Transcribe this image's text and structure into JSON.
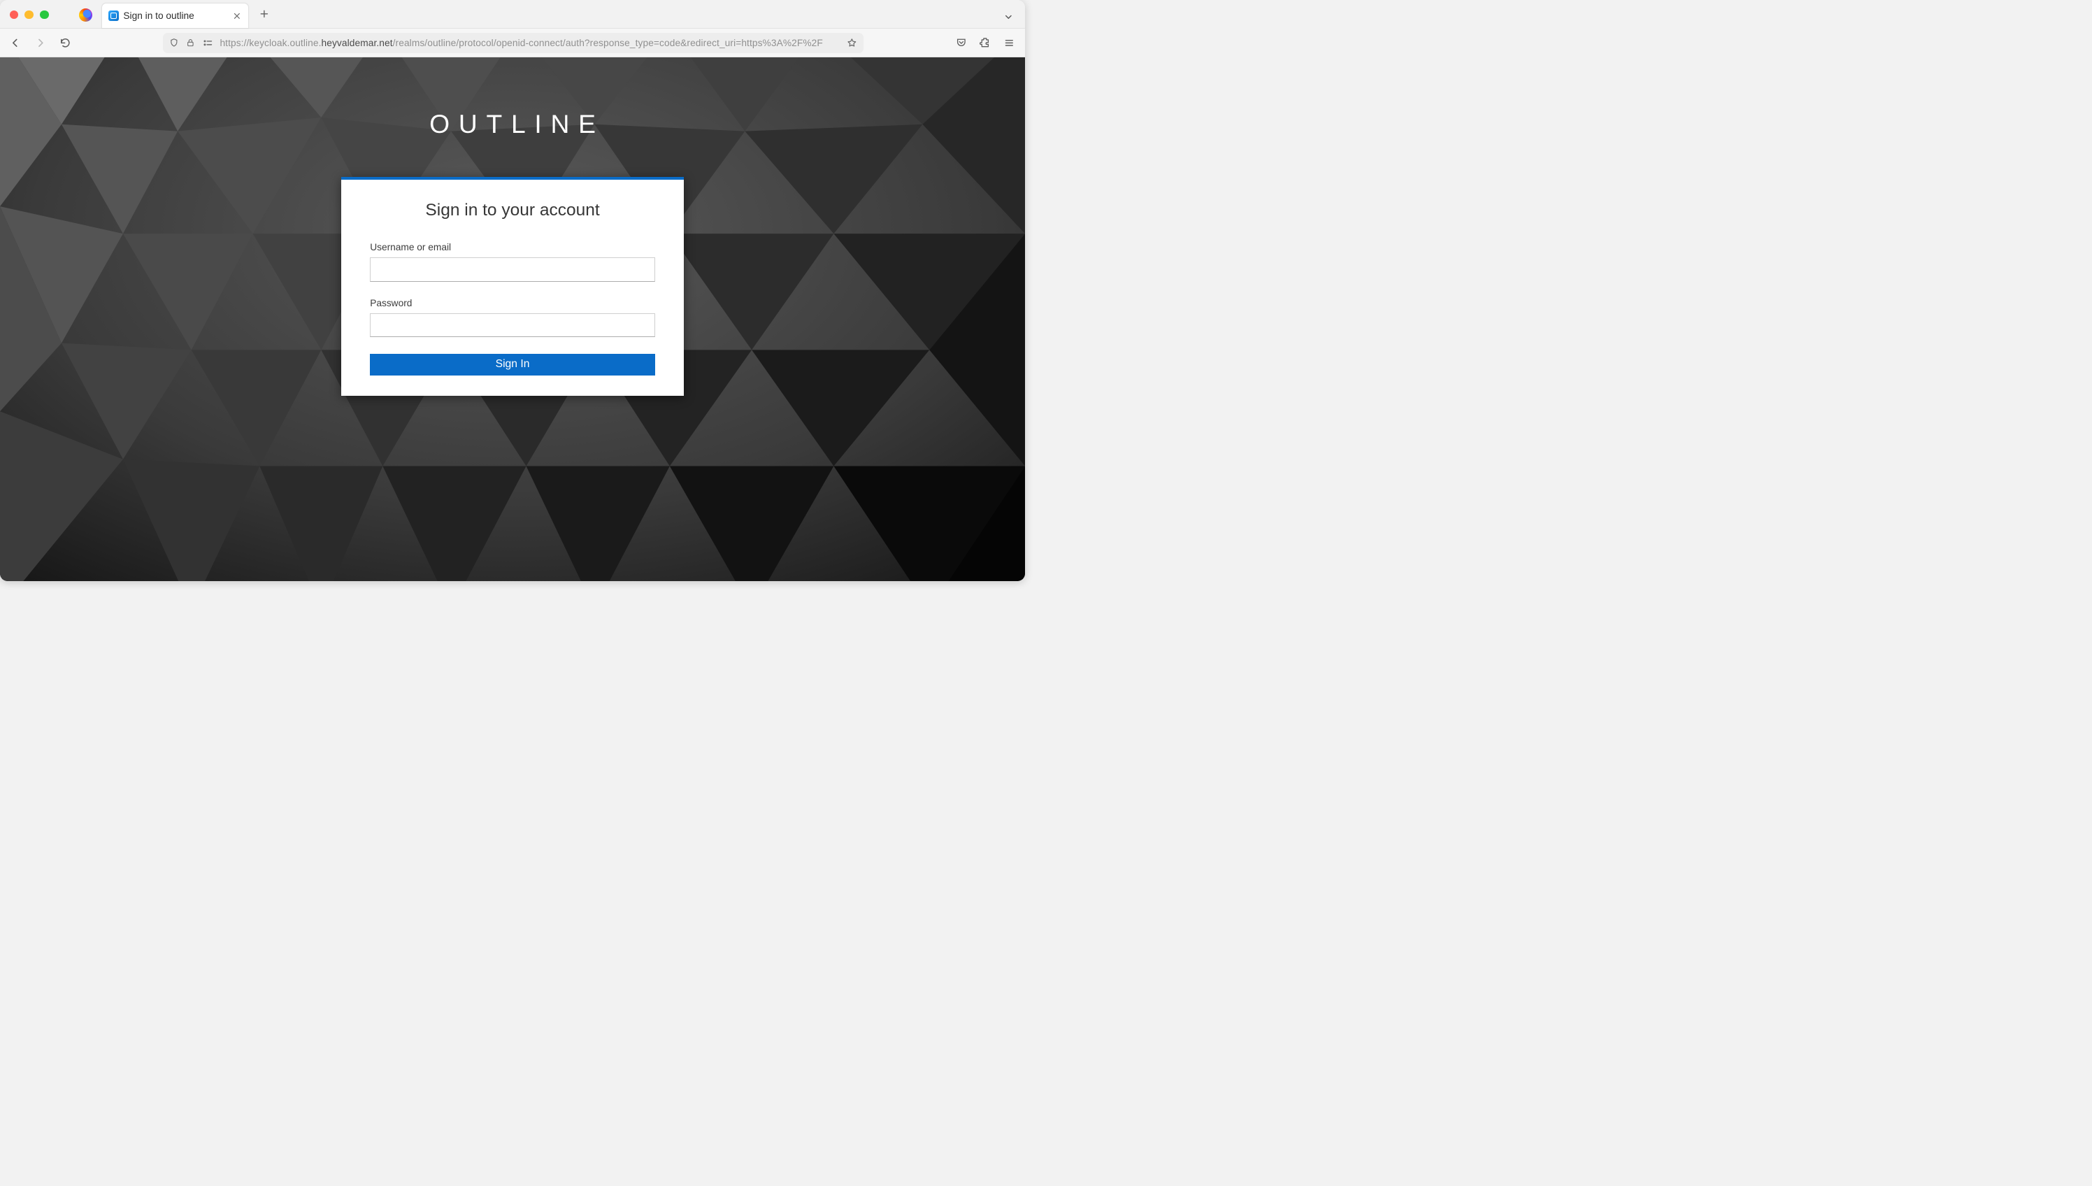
{
  "browser": {
    "tab_title": "Sign in to outline",
    "url_prefix": "https://keycloak.outline.",
    "url_domain": "heyvaldemar.net",
    "url_path": "/realms/outline/protocol/openid-connect/auth?response_type=code&redirect_uri=https%3A%2F%2F"
  },
  "realm": {
    "title": "OUTLINE"
  },
  "login": {
    "heading": "Sign in to your account",
    "username_label": "Username or email",
    "username_value": "",
    "password_label": "Password",
    "password_value": "",
    "submit_label": "Sign In"
  }
}
